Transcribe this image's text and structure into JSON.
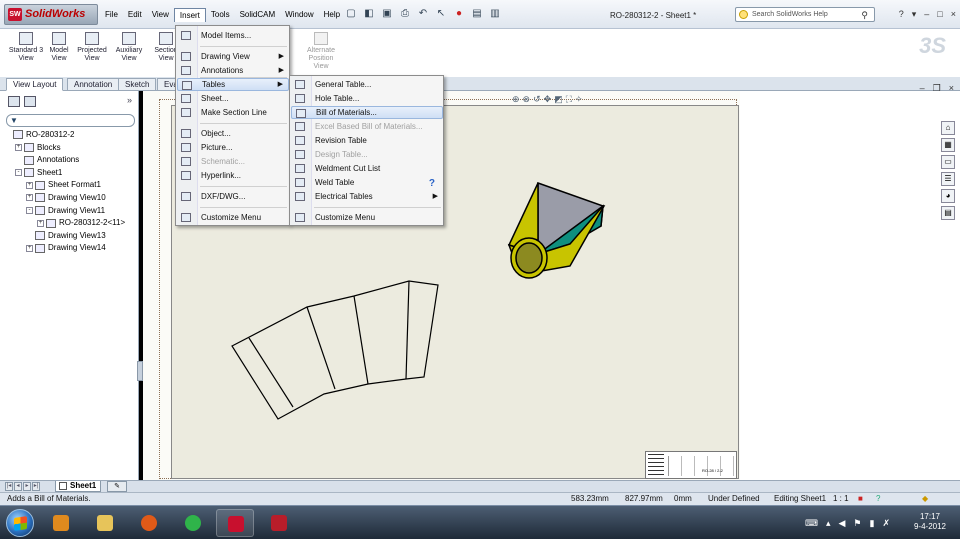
{
  "app": {
    "brand": "SolidWorks",
    "doc_title": "RO-280312-2 - Sheet1 *",
    "menus": [
      "File",
      "Edit",
      "View",
      "Insert",
      "Tools",
      "SolidCAM",
      "Window",
      "Help"
    ],
    "active_menu": "Insert",
    "search_placeholder": "Search SolidWorks Help",
    "window_controls": [
      "?",
      "▾",
      "–",
      "□",
      "×"
    ]
  },
  "command_manager": {
    "buttons": [
      {
        "label": "Standard 3 View",
        "enabled": true
      },
      {
        "label": "Model View",
        "enabled": true
      },
      {
        "label": "Projected View",
        "enabled": true
      },
      {
        "label": "Auxiliary View",
        "enabled": true
      },
      {
        "label": "Section View",
        "enabled": true
      },
      {
        "label": "Alternate Position View",
        "enabled": false
      }
    ]
  },
  "tabs": [
    "View Layout",
    "Annotation",
    "Sketch",
    "Evaluate"
  ],
  "active_tab": "View Layout",
  "feature_tree": {
    "items": [
      {
        "label": "RO-280312-2",
        "level": 0,
        "expand": ""
      },
      {
        "label": "Blocks",
        "level": 1,
        "expand": "+"
      },
      {
        "label": "Annotations",
        "level": 1,
        "expand": ""
      },
      {
        "label": "Sheet1",
        "level": 1,
        "expand": "-"
      },
      {
        "label": "Sheet Format1",
        "level": 2,
        "expand": "+"
      },
      {
        "label": "Drawing View10",
        "level": 2,
        "expand": "+"
      },
      {
        "label": "Drawing View11",
        "level": 2,
        "expand": "-"
      },
      {
        "label": "RO-280312-2<11>",
        "level": 3,
        "expand": "+"
      },
      {
        "label": "Drawing View13",
        "level": 2,
        "expand": ""
      },
      {
        "label": "Drawing View14",
        "level": 2,
        "expand": "+"
      }
    ]
  },
  "insert_menu": {
    "items": [
      {
        "label": "Model Items...",
        "submenu": false,
        "disabled": false,
        "sep_after": true
      },
      {
        "label": "Drawing View",
        "submenu": true,
        "disabled": false,
        "sep_after": false
      },
      {
        "label": "Annotations",
        "submenu": true,
        "disabled": false,
        "sep_after": true
      },
      {
        "label": "Tables",
        "submenu": true,
        "disabled": false,
        "sep_after": false,
        "highlighted": true
      },
      {
        "label": "Sheet...",
        "submenu": false,
        "disabled": false,
        "sep_after": false
      },
      {
        "label": "Make Section Line",
        "submenu": false,
        "disabled": false,
        "sep_after": true
      },
      {
        "label": "Object...",
        "submenu": false,
        "disabled": false,
        "sep_after": false
      },
      {
        "label": "Picture...",
        "submenu": false,
        "disabled": false,
        "sep_after": false
      },
      {
        "label": "Schematic...",
        "submenu": false,
        "disabled": true,
        "sep_after": false
      },
      {
        "label": "Hyperlink...",
        "submenu": false,
        "disabled": false,
        "sep_after": true
      },
      {
        "label": "DXF/DWG...",
        "submenu": false,
        "disabled": false,
        "sep_after": true
      },
      {
        "label": "Customize Menu",
        "submenu": false,
        "disabled": false,
        "sep_after": false
      }
    ]
  },
  "tables_submenu": {
    "items": [
      {
        "label": "General Table...",
        "disabled": false,
        "submenu": false
      },
      {
        "label": "Hole Table...",
        "disabled": false,
        "submenu": false
      },
      {
        "label": "Bill of Materials...",
        "disabled": false,
        "submenu": false,
        "highlighted": true
      },
      {
        "label": "Excel Based Bill of Materials...",
        "disabled": true,
        "submenu": false
      },
      {
        "label": "Revision Table",
        "disabled": false,
        "submenu": false
      },
      {
        "label": "Design Table...",
        "disabled": true,
        "submenu": false
      },
      {
        "label": "Weldment Cut List",
        "disabled": false,
        "submenu": false
      },
      {
        "label": "Weld Table",
        "disabled": false,
        "submenu": false,
        "help": true
      },
      {
        "label": "Electrical Tables",
        "disabled": false,
        "submenu": true
      },
      {
        "label": "Customize Menu",
        "disabled": false,
        "submenu": false
      }
    ]
  },
  "sheet_tabs": {
    "active": "Sheet1"
  },
  "title_block": {
    "text": "RO-28 / 2-2"
  },
  "status_bar": {
    "message": "Adds a Bill of Materials.",
    "x": "583.23mm",
    "y": "827.97mm",
    "z": "0mm",
    "state": "Under Defined",
    "editing": "Editing Sheet1",
    "scale": "1 : 1"
  },
  "clock": {
    "time": "17:17",
    "date": "9-4-2012"
  },
  "colors": {
    "brand_red": "#c8102e",
    "menu_highlight": "#cfdff5",
    "sheet_bg": "#ecebdf",
    "part_yellow": "#c8c400",
    "part_teal": "#0f8f7f"
  }
}
